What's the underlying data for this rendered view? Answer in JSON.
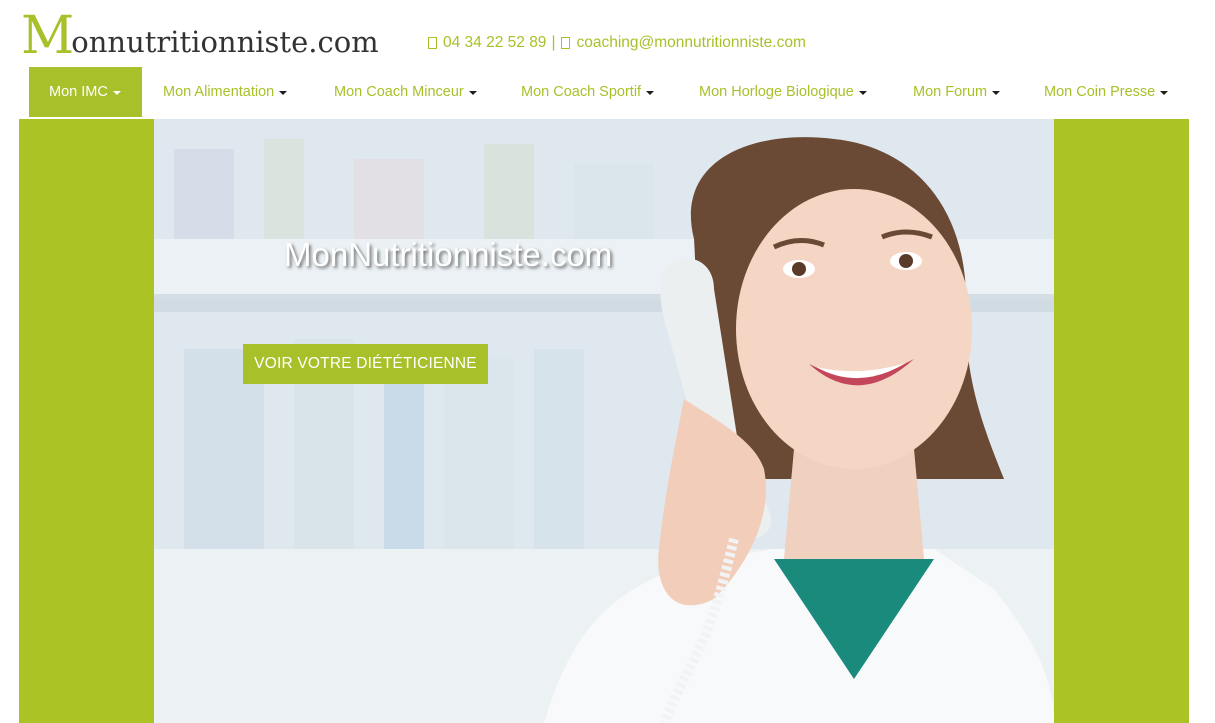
{
  "brand": {
    "logo_initial": "M",
    "logo_rest": "onnutritionniste.com"
  },
  "contact": {
    "phone": "04 34 22 52 89",
    "separator": "|",
    "email": "coaching@monnutritionniste.com"
  },
  "nav": {
    "items": [
      {
        "label": "Mon IMC",
        "active": true
      },
      {
        "label": "Mon Alimentation",
        "active": false
      },
      {
        "label": "Mon Coach Minceur",
        "active": false
      },
      {
        "label": "Mon Coach Sportif",
        "active": false
      },
      {
        "label": "Mon Horloge Biologique",
        "active": false
      },
      {
        "label": "Mon Forum",
        "active": false
      },
      {
        "label": "Mon Coin Presse",
        "active": false
      }
    ]
  },
  "hero": {
    "title": "MonNutritionniste.com",
    "cta_label": "VOIR VOTRE DIÉTÉTICIENNE"
  },
  "colors": {
    "accent": "#a8c12a",
    "hero_side": "#abc325",
    "text_dark": "#333333"
  }
}
